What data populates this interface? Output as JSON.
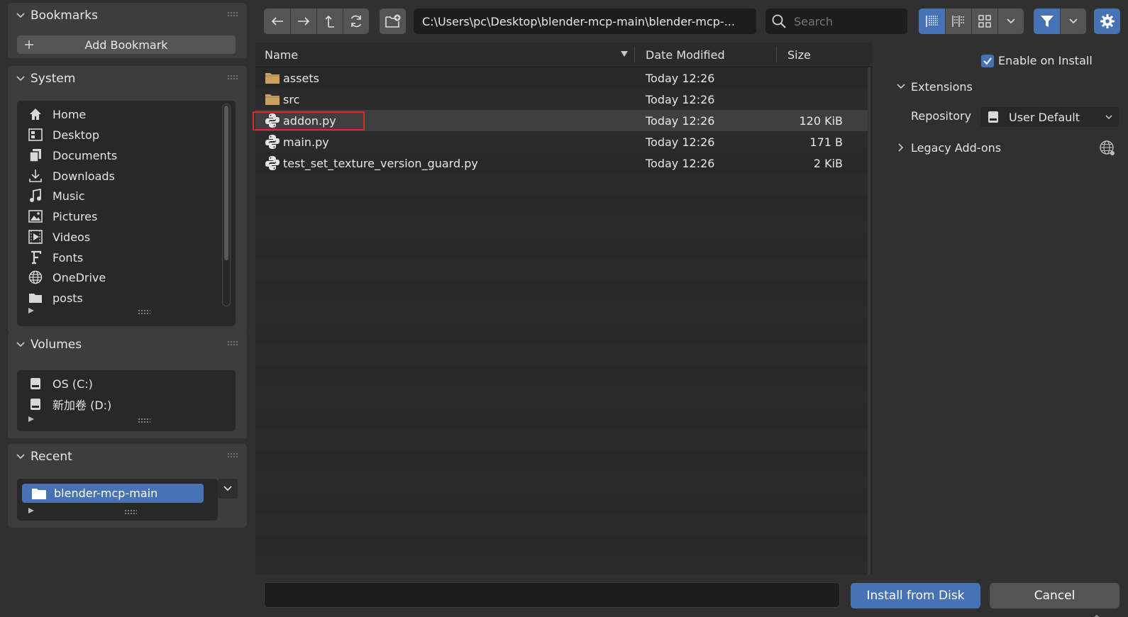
{
  "sidebar": {
    "bookmarks": {
      "title": "Bookmarks",
      "add_label": "Add Bookmark"
    },
    "system": {
      "title": "System",
      "items": [
        {
          "label": "Home",
          "icon": "home-icon"
        },
        {
          "label": "Desktop",
          "icon": "desktop-icon"
        },
        {
          "label": "Documents",
          "icon": "documents-icon"
        },
        {
          "label": "Downloads",
          "icon": "downloads-icon"
        },
        {
          "label": "Music",
          "icon": "music-icon"
        },
        {
          "label": "Pictures",
          "icon": "pictures-icon"
        },
        {
          "label": "Videos",
          "icon": "videos-icon"
        },
        {
          "label": "Fonts",
          "icon": "fonts-icon"
        },
        {
          "label": "OneDrive",
          "icon": "globe-icon"
        },
        {
          "label": "posts",
          "icon": "folder-icon"
        }
      ]
    },
    "volumes": {
      "title": "Volumes",
      "items": [
        {
          "label": "OS (C:)",
          "icon": "drive-icon"
        },
        {
          "label": "新加卷 (D:)",
          "icon": "drive-icon"
        }
      ]
    },
    "recent": {
      "title": "Recent",
      "items": [
        {
          "label": "blender-mcp-main",
          "icon": "folder-icon"
        }
      ]
    }
  },
  "toolbar": {
    "path": "C:\\Users\\pc\\Desktop\\blender-mcp-main\\blender-mcp-...",
    "search_placeholder": "Search"
  },
  "filelist": {
    "columns": {
      "name": "Name",
      "date": "Date Modified",
      "size": "Size"
    },
    "rows": [
      {
        "name": "assets",
        "type": "folder",
        "date": "Today 12:26",
        "size": ""
      },
      {
        "name": "src",
        "type": "folder",
        "date": "Today 12:26",
        "size": ""
      },
      {
        "name": "addon.py",
        "type": "python",
        "date": "Today 12:26",
        "size": "120 KiB"
      },
      {
        "name": "main.py",
        "type": "python",
        "date": "Today 12:26",
        "size": "171 B"
      },
      {
        "name": "test_set_texture_version_guard.py",
        "type": "python",
        "date": "Today 12:26",
        "size": "2 KiB"
      }
    ]
  },
  "options": {
    "enable_on_install": "Enable on Install",
    "enable_on_install_checked": true,
    "extensions_label": "Extensions",
    "repository_label": "Repository",
    "repository_value": "User Default",
    "legacy_label": "Legacy Add-ons"
  },
  "footer": {
    "filename_value": "",
    "install_label": "Install from Disk",
    "cancel_label": "Cancel"
  },
  "colors": {
    "accent": "#4772b3",
    "highlight_box": "#e02828",
    "folder": "#c8a060"
  }
}
